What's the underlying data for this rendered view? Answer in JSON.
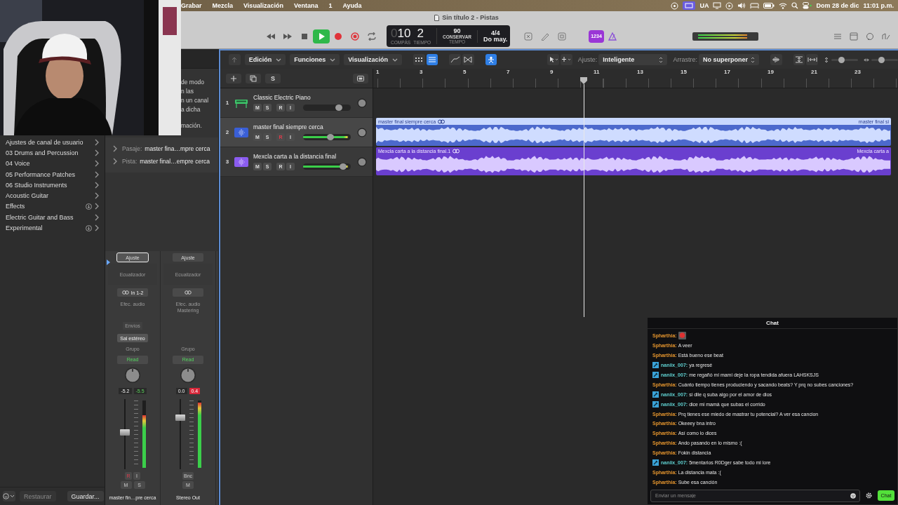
{
  "menubar": {
    "items": [
      "Grabar",
      "Mezcla",
      "Visualización",
      "Ventana",
      "1",
      "Ayuda"
    ],
    "input_source": "UA",
    "date": "Dom 28 de dic",
    "time": "11:01 p.m."
  },
  "window": {
    "title": "Sin título 2 - Pistas"
  },
  "transport": {
    "playing": true,
    "lcd": {
      "bar_prefix": "0",
      "bar": "10",
      "beat": "2",
      "bar_label": "COMPÁS",
      "beat_label": "TIEMPO",
      "tempo": "90",
      "tempo_mode": "CONSERVAR",
      "tempo_label": "TEMPO",
      "signature": "4/4",
      "key": "Do may."
    },
    "count_in": "1234"
  },
  "library": {
    "items": [
      {
        "label": "Ajustes de canal de usuario",
        "download": false
      },
      {
        "label": "03 Drums and Percussion",
        "download": false
      },
      {
        "label": "04 Voice",
        "download": false
      },
      {
        "label": "05 Performance Patches",
        "download": false
      },
      {
        "label": "06 Studio Instruments",
        "download": false
      },
      {
        "label": "Acoustic Guitar",
        "download": false
      },
      {
        "label": "Effects",
        "download": true
      },
      {
        "label": "Electric Guitar and Bass",
        "download": false
      },
      {
        "label": "Experimental",
        "download": true
      }
    ],
    "revert": "Restaurar",
    "save": "Guardar..."
  },
  "inspector": {
    "help_lines": [
      "de modo",
      "n las",
      "n un canal",
      "a dicha",
      "mación."
    ],
    "rows": [
      {
        "label": "Pasaje:",
        "value": "master fina…mpre cerca"
      },
      {
        "label": "Pista:",
        "value": "master final…empre cerca"
      }
    ],
    "strips": [
      {
        "setting": "Ajuste",
        "setting_selected": true,
        "eq": "Ecualizador",
        "input": "In 1-2",
        "effects": [
          "Efec. audio"
        ],
        "sends": "Envíos",
        "output": "Sal estéreo",
        "group": "Grupo",
        "automation": "Read",
        "readouts": [
          {
            "text": "-5.2",
            "kind": "plain"
          },
          {
            "text": "-5.5",
            "kind": "green"
          }
        ],
        "fader": {
          "level": 0.52
        },
        "meter": {
          "level": 0.78
        },
        "upper_buttons": [
          {
            "label": "R",
            "on": true
          },
          {
            "label": "I",
            "on": false
          }
        ],
        "lower_buttons": [
          "M",
          "S"
        ],
        "name": "master fin…pre cerca"
      },
      {
        "setting": "Ajuste",
        "setting_selected": false,
        "eq": "Ecualizador",
        "effects": [
          "Efec. audio",
          "Mastering"
        ],
        "group": "Grupo",
        "automation": "Read",
        "readouts": [
          {
            "text": "0.0",
            "kind": "plain"
          },
          {
            "text": "0.4",
            "kind": "clip"
          }
        ],
        "fader": {
          "level": 0.75
        },
        "meter": {
          "level": 0.97
        },
        "upper_buttons": [
          {
            "label": "Bnc",
            "on": false
          }
        ],
        "lower_buttons": [
          "M"
        ],
        "name": "Stereo Out"
      }
    ]
  },
  "tracks_toolbar": {
    "menus": [
      "Edición",
      "Funciones",
      "Visualización"
    ],
    "snap_label": "Ajuste:",
    "snap": "Inteligente",
    "drag_label": "Arrastre:",
    "drag": "No superponer",
    "zoom_sliders": [
      {
        "level": 0.35
      },
      {
        "level": 0.35
      }
    ]
  },
  "track_list_toolbar": {
    "solo_label": "S"
  },
  "ruler": [
    "1",
    "3",
    "5",
    "7",
    "9",
    "11",
    "13",
    "15",
    "17",
    "19",
    "21",
    "23"
  ],
  "tracks": [
    {
      "number": "1",
      "name": "Classic Electric Piano",
      "kind": "instrument",
      "color": "#3ec46a",
      "selected": false,
      "signal": false,
      "level": 0.8,
      "buttons": [
        {
          "label": "M",
          "on": false
        },
        {
          "label": "S",
          "on": false
        },
        {
          "label": "R",
          "on": false
        },
        {
          "label": "I",
          "on": false
        }
      ]
    },
    {
      "number": "2",
      "name": "master final siempre cerca",
      "kind": "audio",
      "color": "#3a5fd6",
      "selected": true,
      "signal": true,
      "level": 0.58,
      "buttons": [
        {
          "label": "M",
          "on": false
        },
        {
          "label": "S",
          "on": false
        },
        {
          "label": "R",
          "on": true
        },
        {
          "label": "I",
          "on": false
        }
      ],
      "region": {
        "name": "master final siempre cerca",
        "end_name": "master final si",
        "kind": "blue"
      }
    },
    {
      "number": "3",
      "name": "Mexcla carta a la distancia final",
      "kind": "audio",
      "color": "#8b5cf0",
      "selected": false,
      "signal": true,
      "level": 0.9,
      "buttons": [
        {
          "label": "M",
          "on": false
        },
        {
          "label": "S",
          "on": false
        },
        {
          "label": "R",
          "on": false
        },
        {
          "label": "I",
          "on": false
        }
      ],
      "region": {
        "name": "Mexcla carta a la distancia final.1",
        "end_name": "Mexcla carta a",
        "kind": "purple"
      }
    }
  ],
  "chat": {
    "title": "Chat",
    "messages": [
      {
        "user": "Spharthia:",
        "color": "#e6962e",
        "badge": false,
        "emote": true
      },
      {
        "user": "Spharthia:",
        "color": "#e6962e",
        "badge": false,
        "text": "A veer"
      },
      {
        "user": "Spharthia:",
        "color": "#e6962e",
        "badge": false,
        "text": "Está bueno ese beat"
      },
      {
        "user": "naniix_007:",
        "color": "#5fd0d0",
        "badge": true,
        "text": "ya regresé"
      },
      {
        "user": "naniix_007:",
        "color": "#5fd0d0",
        "badge": true,
        "text": "me regañó mi mami deje la ropa tendida afuera LAHSKSJS"
      },
      {
        "user": "Spharthia:",
        "color": "#e6962e",
        "badge": false,
        "text": "Cuánto tiempo tienes produciendo y sacando beats? Y prq no subes canciones?"
      },
      {
        "user": "naniix_007:",
        "color": "#5fd0d0",
        "badge": true,
        "text": "si dile q suba algo por el amor de dios"
      },
      {
        "user": "naniix_007:",
        "color": "#5fd0d0",
        "badge": true,
        "text": "dice mi mamá que subas el corrido"
      },
      {
        "user": "Spharthia:",
        "color": "#e6962e",
        "badge": false,
        "text": "Prq tienes ese miedo de mastrar tu potencial? A ver esa cancion"
      },
      {
        "user": "Spharthia:",
        "color": "#e6962e",
        "badge": false,
        "text": "Okeeey bna intro"
      },
      {
        "user": "Spharthia:",
        "color": "#e6962e",
        "badge": false,
        "text": "Así como lo dices"
      },
      {
        "user": "Spharthia:",
        "color": "#e6962e",
        "badge": false,
        "text": "Ando pasando en lo mismo :("
      },
      {
        "user": "Spharthia:",
        "color": "#e6962e",
        "badge": false,
        "text": "Fokin distancia"
      },
      {
        "user": "naniix_007:",
        "color": "#5fd0d0",
        "badge": true,
        "text": "5mentarios R0Dger sabe todo mi lore"
      },
      {
        "user": "Spharthia:",
        "color": "#e6962e",
        "badge": false,
        "text": "La distancia mata :("
      },
      {
        "user": "Spharthia:",
        "color": "#e6962e",
        "badge": false,
        "text": "Sube esa canción"
      }
    ],
    "placeholder": "Enviar un mensaje",
    "send": "Chat"
  }
}
